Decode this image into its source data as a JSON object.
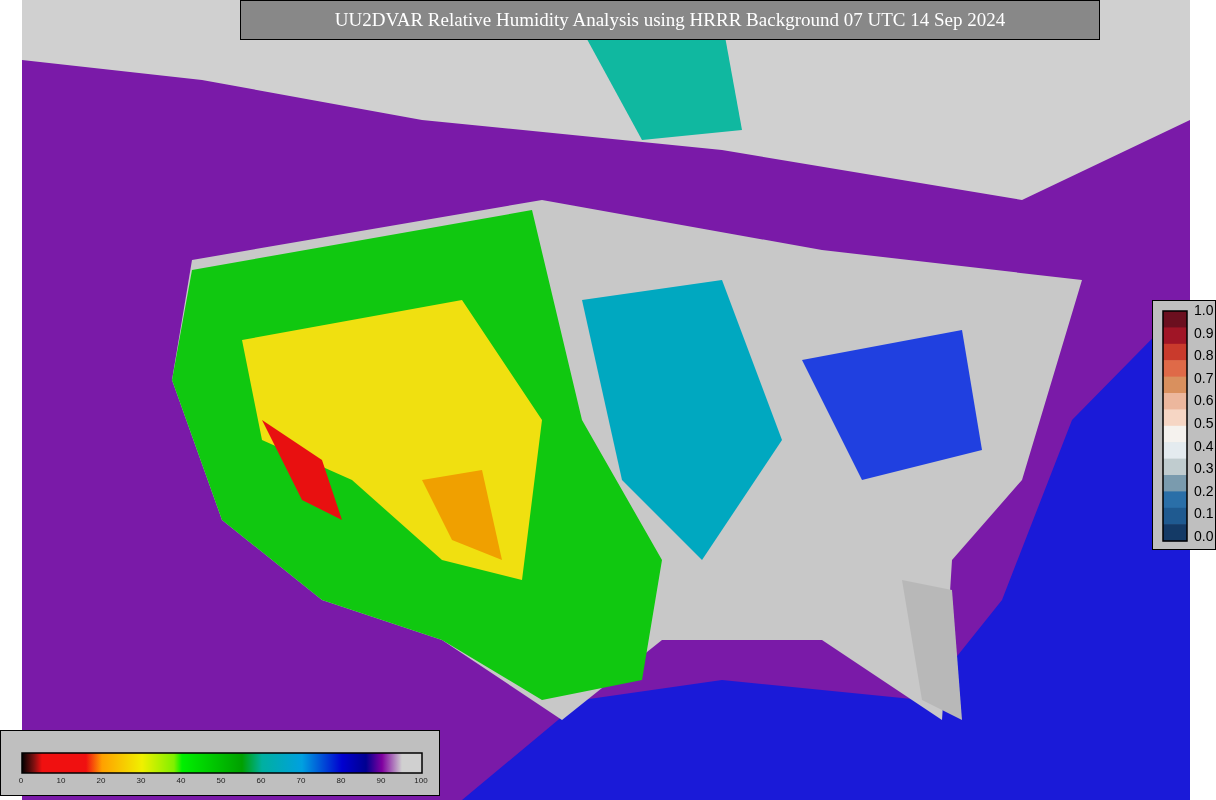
{
  "title": "UU2DVAR Relative Humidity Analysis using HRRR Background 07 UTC 14 Sep 2024",
  "ratio_colorbar": {
    "ticks": [
      "1.0",
      "0.9",
      "0.8",
      "0.7",
      "0.6",
      "0.5",
      "0.4",
      "0.3",
      "0.2",
      "0.1",
      "0.0"
    ]
  },
  "humidity_colorbar": {
    "ticks": [
      "0",
      "10",
      "20",
      "30",
      "40",
      "50",
      "60",
      "70",
      "80",
      "90",
      "100"
    ]
  }
}
